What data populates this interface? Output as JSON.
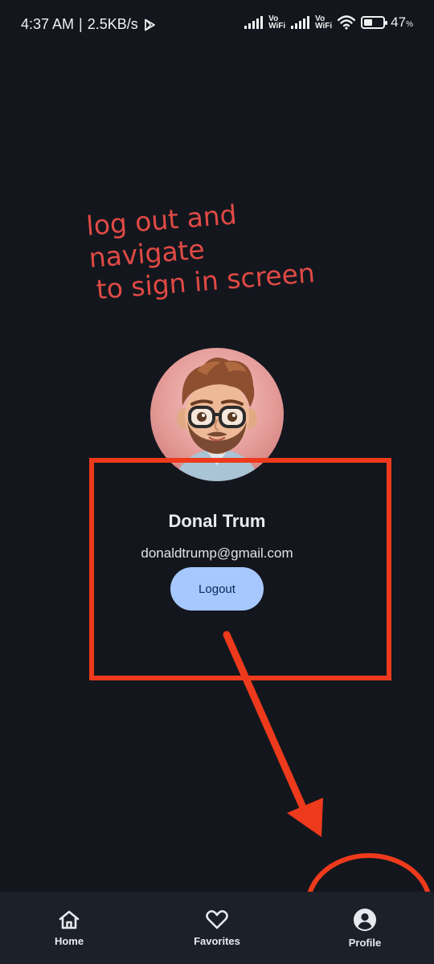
{
  "status_bar": {
    "time": "4:37 AM",
    "separator": "|",
    "speed": "2.5KB/s",
    "battery": "47",
    "battery_unit": "%",
    "battery_level": 0.47,
    "vo_wifi_1": "Vo\nWiFi",
    "vo_wifi_2": "Vo\nWiFi"
  },
  "annotation": {
    "line1": "log out and navigate",
    "line2": "to sign in screen",
    "color": "#e04a45",
    "highlight_color": "#ee3a1c"
  },
  "profile": {
    "name": "Donal Trum",
    "email": "donaldtrump@gmail.com",
    "logout_label": "Logout"
  },
  "nav": {
    "items": [
      {
        "label": "Home",
        "icon": "home-icon"
      },
      {
        "label": "Favorites",
        "icon": "heart-icon"
      },
      {
        "label": "Profile",
        "icon": "account-circle-icon"
      }
    ],
    "active": "Profile"
  },
  "colors": {
    "background": "#13161d",
    "nav_background": "#1c2028",
    "button": "#a6c8ff",
    "button_text": "#0a2a55"
  }
}
